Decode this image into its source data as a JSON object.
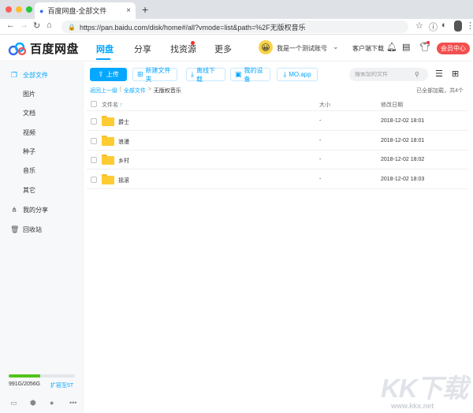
{
  "browser": {
    "tab_title": "百度网盘-全部文件",
    "url": "https://pan.baidu.com/disk/home#/all?vmode=list&path=%2F无版权音乐"
  },
  "header": {
    "logo_text": "百度网盘",
    "nav": [
      {
        "label": "网盘",
        "active": true
      },
      {
        "label": "分享",
        "active": false
      },
      {
        "label": "找资源",
        "active": false
      },
      {
        "label": "更多",
        "active": false
      }
    ],
    "username": "我是一个测试账号",
    "client_download": "客户端下载",
    "vip_button": "会员中心"
  },
  "sidebar": {
    "all_files": "全部文件",
    "categories": [
      "图片",
      "文档",
      "视频",
      "种子",
      "音乐",
      "其它"
    ],
    "my_share": "我的分享",
    "recycle_bin": "回收站",
    "quota_text": "991G/2056G",
    "quota_fraction": 0.48,
    "expand_label": "扩容至5T"
  },
  "toolbar": {
    "upload": "上传",
    "new_folder": "新建文件夹",
    "offline_download": "离线下载",
    "my_devices": "我的设备",
    "mo_app": "MO.app",
    "search_placeholder": "搜索您的文件"
  },
  "breadcrumb": {
    "back": "返回上一级",
    "sep": "|",
    "all": "全部文件",
    "arrow": ">",
    "current": "无版权音乐"
  },
  "loaded_text": "已全部加载，共4个",
  "table": {
    "headers": {
      "name": "文件名",
      "size": "大小",
      "date": "修改日期"
    },
    "rows": [
      {
        "name": "爵士",
        "size": "-",
        "date": "2018-12-02 18:01"
      },
      {
        "name": "浪漫",
        "size": "-",
        "date": "2018-12-02 18:01"
      },
      {
        "name": "乡村",
        "size": "-",
        "date": "2018-12-02 18:02"
      },
      {
        "name": "摇滚",
        "size": "-",
        "date": "2018-12-02 18:03"
      }
    ]
  },
  "watermark": {
    "brand": "KK下载",
    "url": "www.kkx.net"
  },
  "colors": {
    "accent": "#06a7ff",
    "vip": "#f24f4f",
    "quota": "#52c41a",
    "folder": "#ffcb32"
  }
}
